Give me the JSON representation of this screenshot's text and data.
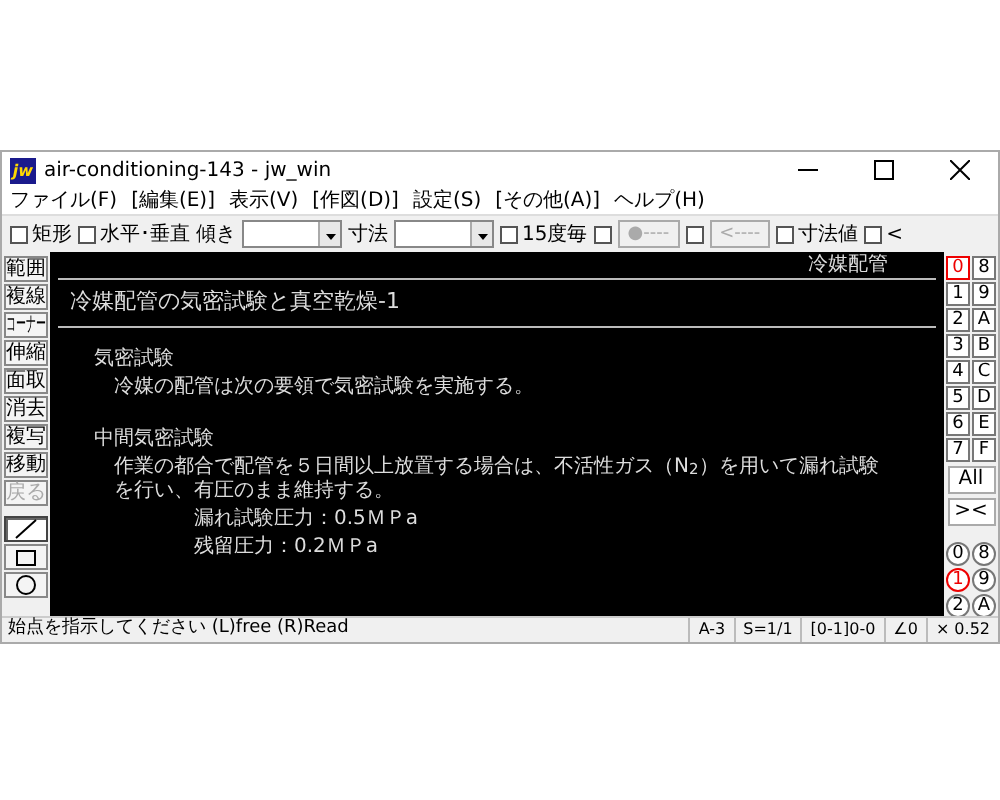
{
  "window": {
    "logo": "jw",
    "title": "air-conditioning-143 - jw_win"
  },
  "menu": [
    {
      "label": "ファイル(F)"
    },
    {
      "label": "[編集(E)]"
    },
    {
      "label": "表示(V)"
    },
    {
      "label": "[作図(D)]"
    },
    {
      "label": "設定(S)"
    },
    {
      "label": "[その他(A)]"
    },
    {
      "label": "ヘルプ(H)"
    }
  ],
  "toolbar": [
    {
      "kind": "checkbox",
      "label": "矩形",
      "checked": false
    },
    {
      "kind": "checkbox",
      "label": "水平･垂直",
      "checked": false
    },
    {
      "kind": "label",
      "text": "傾き"
    },
    {
      "kind": "combo"
    },
    {
      "kind": "label",
      "text": "寸法"
    },
    {
      "kind": "combo"
    },
    {
      "kind": "checkbox",
      "label": "15度毎",
      "checked": false
    },
    {
      "kind": "checkbox",
      "checked": false
    },
    {
      "kind": "button",
      "text": "●----",
      "disabled": true
    },
    {
      "kind": "checkbox",
      "checked": false
    },
    {
      "kind": "button",
      "text": "<----",
      "disabled": true
    },
    {
      "kind": "checkbox",
      "label": "寸法値",
      "checked": false
    },
    {
      "kind": "checkbox",
      "label": "<",
      "checked": false
    }
  ],
  "left_tools": [
    {
      "kind": "text",
      "label": "範囲",
      "disabled": false
    },
    {
      "kind": "text",
      "label": "複線",
      "disabled": false
    },
    {
      "kind": "text",
      "label": "コーナー",
      "disabled": false
    },
    {
      "kind": "text",
      "label": "伸縮",
      "disabled": false
    },
    {
      "kind": "text",
      "label": "面取",
      "disabled": false
    },
    {
      "kind": "text",
      "label": "消去",
      "disabled": false
    },
    {
      "kind": "text",
      "label": "複写",
      "disabled": false
    },
    {
      "kind": "text",
      "label": "移動",
      "disabled": false
    },
    {
      "kind": "text",
      "label": "戻る",
      "disabled": true
    },
    {
      "kind": "line",
      "selected": true
    },
    {
      "kind": "rect",
      "selected": false
    },
    {
      "kind": "circle",
      "selected": false
    }
  ],
  "canvas": {
    "corner_text": "冷媒配管",
    "title": "冷媒配管の気密試験と真空乾燥-1",
    "paragraphs": [
      {
        "kind": "heading",
        "text": "気密試験"
      },
      {
        "kind": "body",
        "text": "冷媒の配管は次の要領で気密試験を実施する。"
      },
      {
        "kind": "gap"
      },
      {
        "kind": "heading",
        "text": "中間気密試験"
      },
      {
        "kind": "body",
        "text": "作業の都合で配管を５日間以上放置する場合は、不活性ガス（N$_{2}$）を用いて漏れ試験を行い、有圧のまま維持する。"
      },
      {
        "kind": "indent",
        "text": "漏れ試験圧力：0.5ＭＰa"
      },
      {
        "kind": "indent",
        "text": "残留圧力：0.2ＭＰa"
      }
    ]
  },
  "layers": [
    {
      "label": "0",
      "selected": true
    },
    {
      "label": "8",
      "selected": false
    },
    {
      "label": "1",
      "selected": false
    },
    {
      "label": "9",
      "selected": false
    },
    {
      "label": "2",
      "selected": false
    },
    {
      "label": "A",
      "selected": false
    },
    {
      "label": "3",
      "selected": false
    },
    {
      "label": "B",
      "selected": false
    },
    {
      "label": "4",
      "selected": false
    },
    {
      "label": "C",
      "selected": false
    },
    {
      "label": "5",
      "selected": false
    },
    {
      "label": "D",
      "selected": false
    },
    {
      "label": "6",
      "selected": false
    },
    {
      "label": "E",
      "selected": false
    },
    {
      "label": "7",
      "selected": false
    },
    {
      "label": "F",
      "selected": false
    }
  ],
  "layer_buttons": [
    {
      "label": "All"
    },
    {
      "label": "><"
    }
  ],
  "layer_groups": [
    {
      "label": "0",
      "selected": false
    },
    {
      "label": "8",
      "selected": false
    },
    {
      "label": "1",
      "selected": true
    },
    {
      "label": "9",
      "selected": false
    },
    {
      "label": "2",
      "selected": false
    },
    {
      "label": "A",
      "selected": false
    }
  ],
  "status_bar": {
    "message": "始点を指示してください (L)free (R)Read",
    "cells": [
      {
        "text": "A-3"
      },
      {
        "text": "S=1/1"
      },
      {
        "text": "[0-1]0-0"
      },
      {
        "text": "∠0"
      },
      {
        "text": "× 0.52"
      }
    ]
  }
}
